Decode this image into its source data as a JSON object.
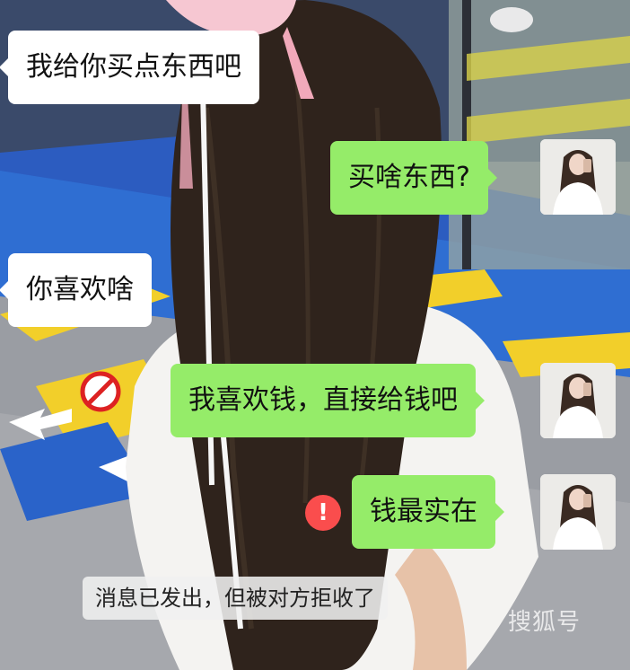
{
  "messages": [
    {
      "side": "left",
      "text": "我给你买点东西吧"
    },
    {
      "side": "right",
      "text": "买啥东西?"
    },
    {
      "side": "left",
      "text": "你喜欢啥"
    },
    {
      "side": "right",
      "text": "我喜欢钱，直接给钱吧"
    },
    {
      "side": "right",
      "text": "钱最实在",
      "failed": true
    }
  ],
  "error_badge": "!",
  "system_notice": "消息已发出，但被对方拒收了",
  "watermark": "搜狐号"
}
